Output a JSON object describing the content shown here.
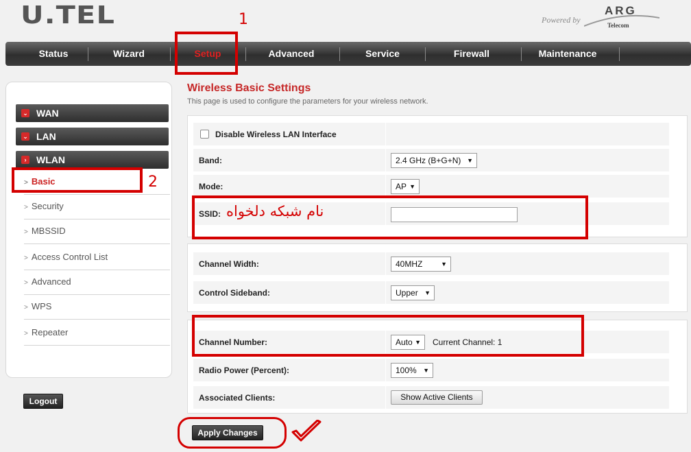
{
  "header": {
    "logo_text": "U.TEL",
    "powered_by": "Powered by",
    "brand": "ARG",
    "brand_sub": "Telecom"
  },
  "annotations": {
    "num1": "1",
    "num2": "2",
    "persian_text": "نام شبکه دلخواه"
  },
  "nav": {
    "items": [
      {
        "label": "Status"
      },
      {
        "label": "Wizard"
      },
      {
        "label": "Setup",
        "active": true
      },
      {
        "label": "Advanced"
      },
      {
        "label": "Service"
      },
      {
        "label": "Firewall"
      },
      {
        "label": "Maintenance"
      }
    ]
  },
  "sidebar": {
    "sections": [
      {
        "label": "WAN"
      },
      {
        "label": "LAN"
      },
      {
        "label": "WLAN"
      }
    ],
    "items": [
      {
        "label": "Basic",
        "active": true
      },
      {
        "label": "Security"
      },
      {
        "label": "MBSSID"
      },
      {
        "label": "Access Control List"
      },
      {
        "label": "Advanced"
      },
      {
        "label": "WPS"
      },
      {
        "label": "Repeater"
      }
    ],
    "logout_label": "Logout"
  },
  "main": {
    "title": "Wireless Basic Settings",
    "description": "This page is used to configure the parameters for your wireless network.",
    "disable_label": "Disable Wireless LAN Interface",
    "disable_checked": false,
    "band_label": "Band:",
    "band_value": "2.4 GHz (B+G+N)",
    "mode_label": "Mode:",
    "mode_value": "AP",
    "ssid_label": "SSID:",
    "ssid_value": "",
    "channel_width_label": "Channel Width:",
    "channel_width_value": "40MHZ",
    "control_sideband_label": "Control Sideband:",
    "control_sideband_value": "Upper",
    "channel_number_label": "Channel Number:",
    "channel_number_value": "Auto",
    "current_channel_text": "Current Channel: 1",
    "radio_power_label": "Radio Power (Percent):",
    "radio_power_value": "100%",
    "associated_clients_label": "Associated Clients:",
    "show_clients_label": "Show Active Clients",
    "apply_label": "Apply Changes"
  },
  "colors": {
    "accent_red": "#c62828",
    "annotation_red": "#d40000"
  }
}
